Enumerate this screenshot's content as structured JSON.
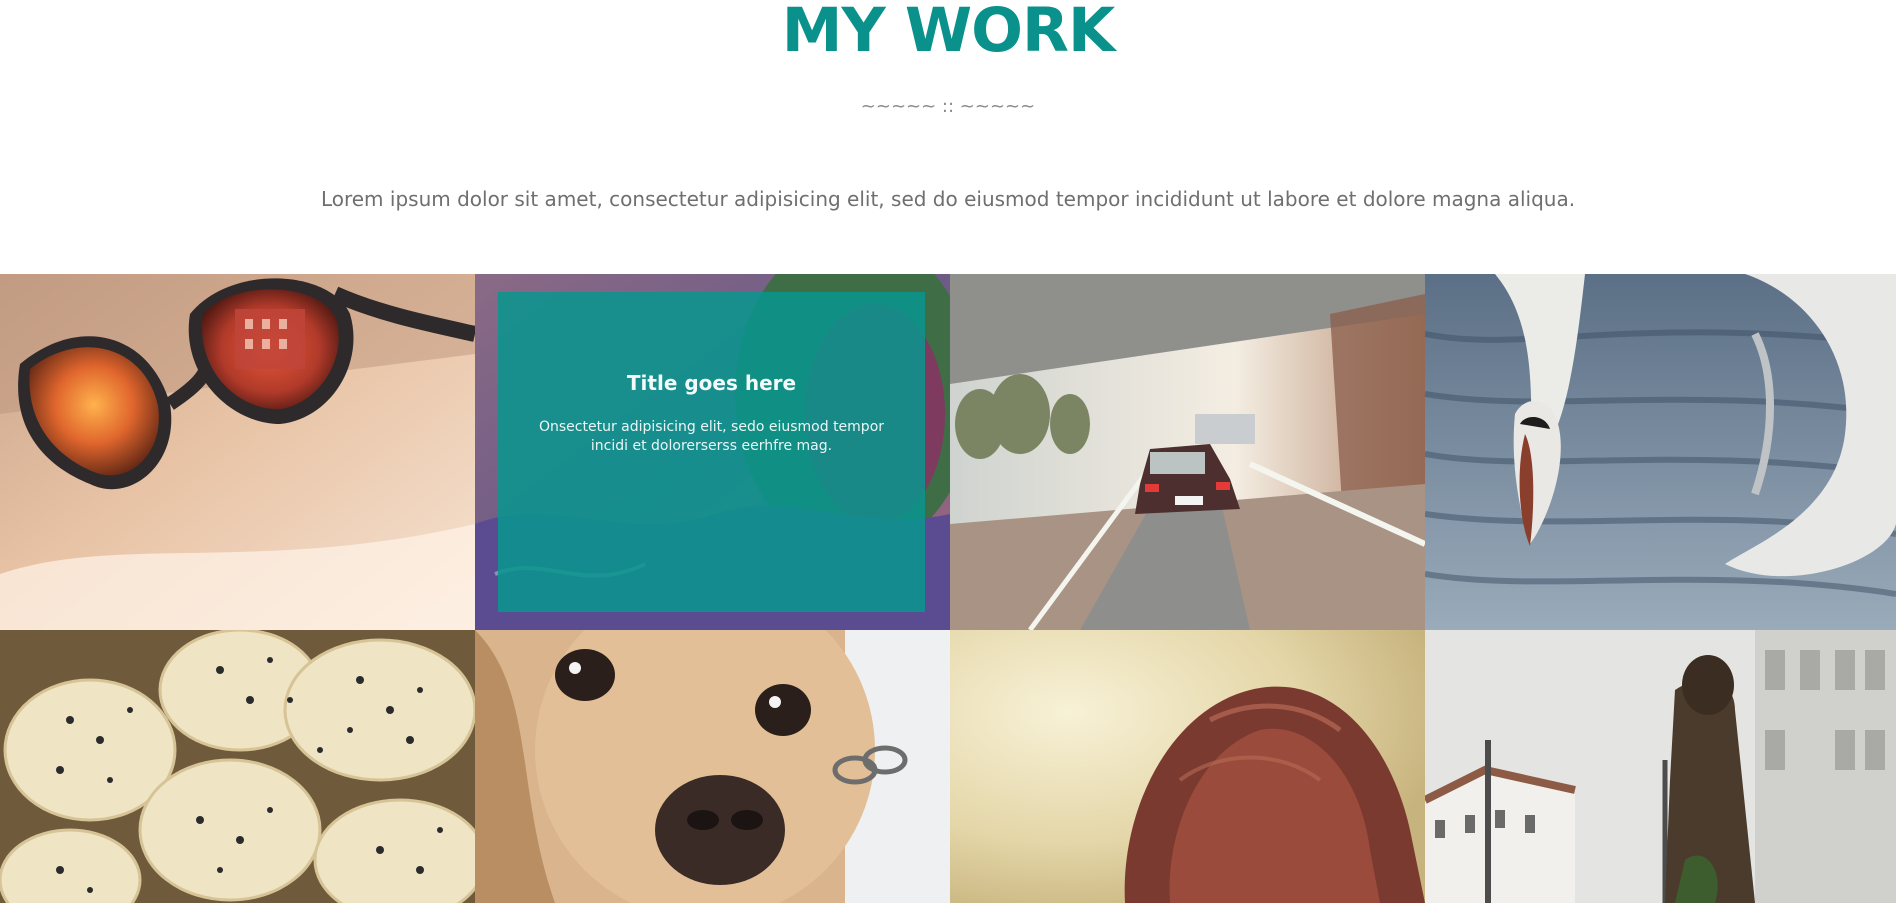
{
  "section": {
    "title": "MY WORK",
    "divider": "~~~~~ :: ~~~~~",
    "intro": "Lorem ipsum dolor sit amet, consectetur adipisicing elit, sed do eiusmod tempor incididunt ut labore et dolore magna aliqua."
  },
  "portfolio": {
    "items": [
      {
        "image": "sunglasses-photo"
      },
      {
        "image": "leaves-photo",
        "overlay_title": "Title goes here",
        "overlay_text": "Onsectetur adipisicing elit, sedo eiusmod tempor incidi et dolorerserss eerhfre mag."
      },
      {
        "image": "car-tunnel-photo"
      },
      {
        "image": "swan-photo"
      },
      {
        "image": "banana-chia-photo"
      },
      {
        "image": "dog-photo"
      },
      {
        "image": "red-hair-photo"
      },
      {
        "image": "woman-street-photo"
      }
    ]
  },
  "colors": {
    "accent": "#0a918b",
    "text_muted": "#6f6f6f",
    "overlay": "rgba(8, 150, 142, 0.86)"
  }
}
